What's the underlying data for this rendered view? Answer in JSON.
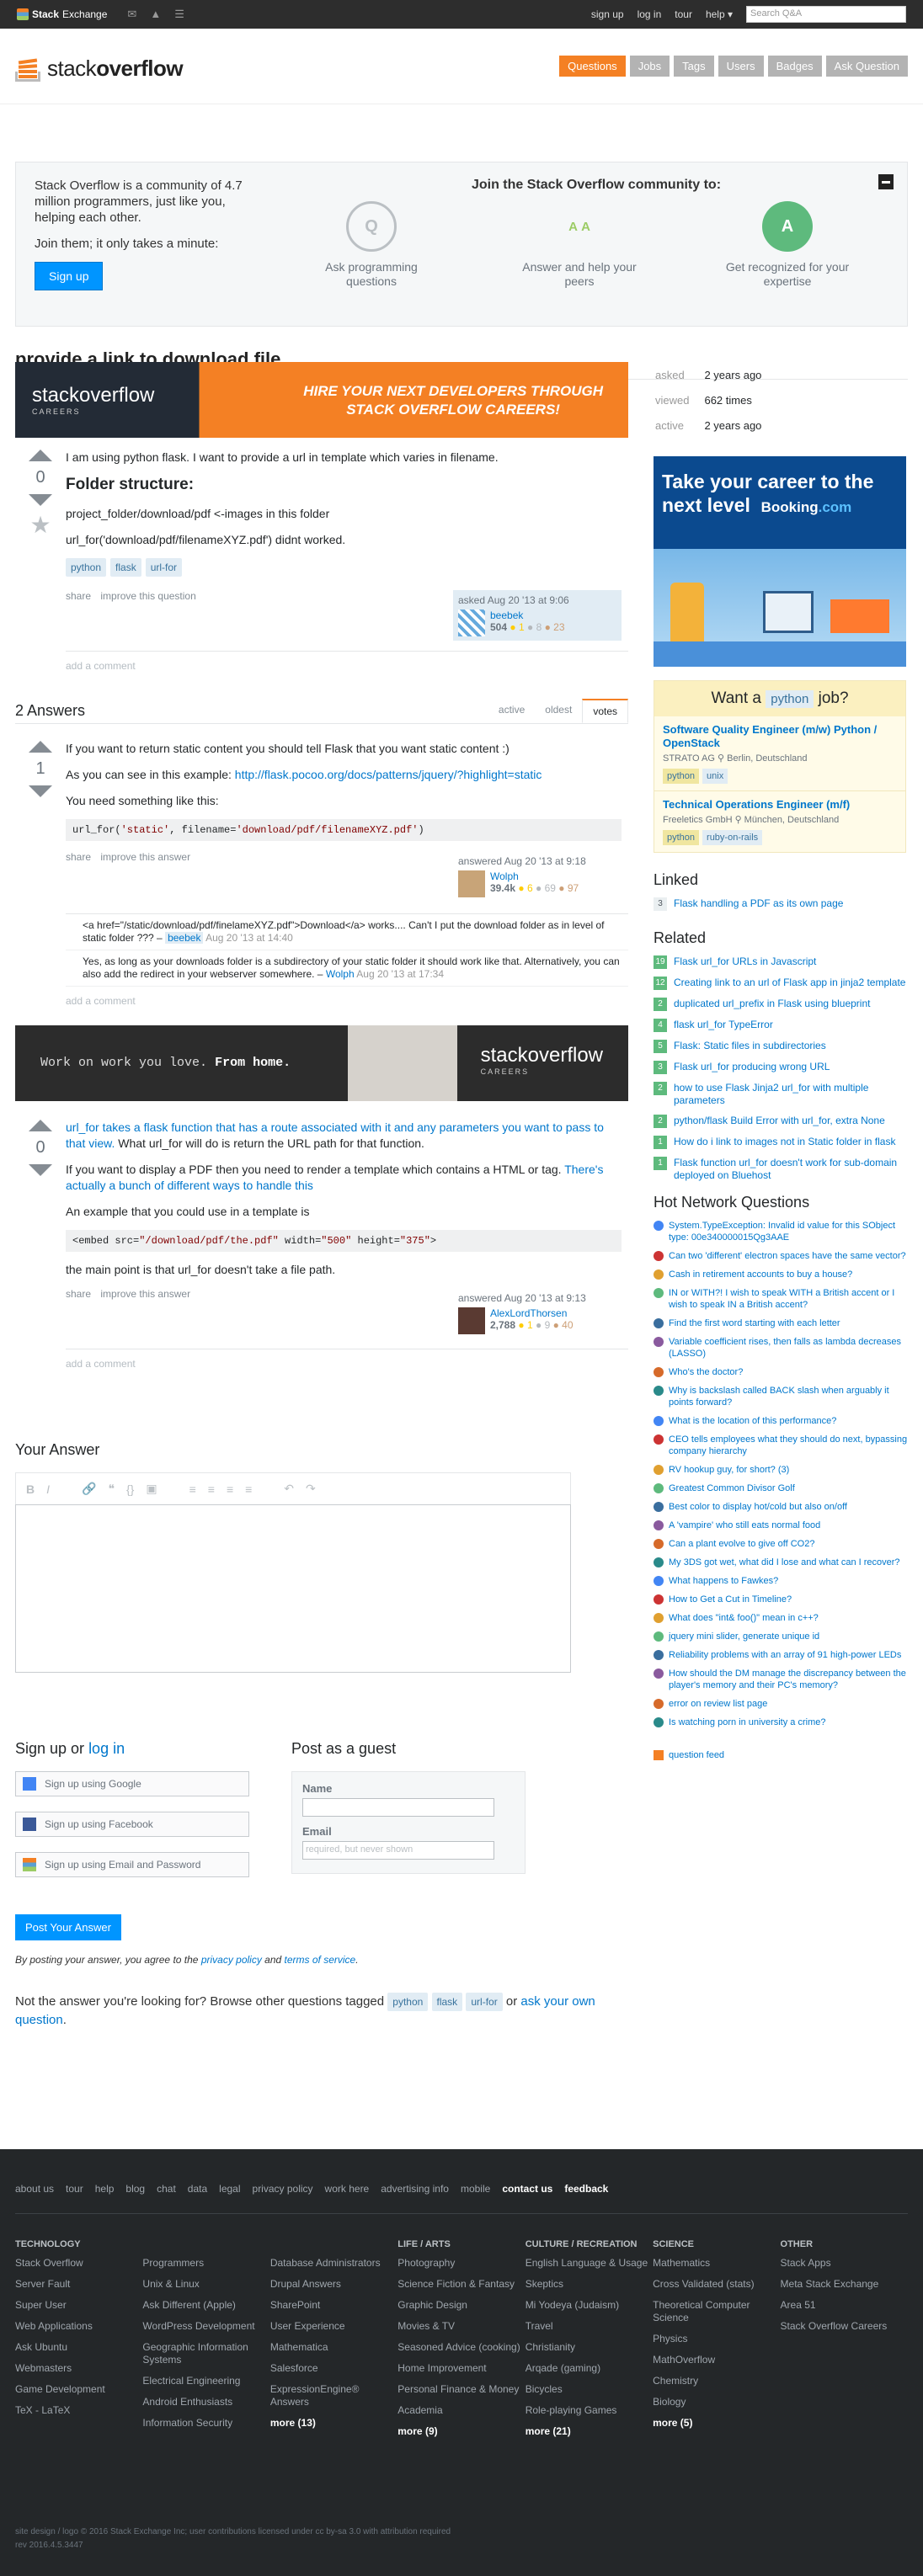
{
  "topbar": {
    "brand_a": "Stack",
    "brand_b": "Exchange",
    "links": [
      "sign up",
      "log in",
      "tour",
      "help ▾"
    ],
    "search_placeholder": "Search Q&A"
  },
  "logo": {
    "light": "stack",
    "bold": "overflow"
  },
  "nav": [
    "Questions",
    "Jobs",
    "Tags",
    "Users",
    "Badges",
    "Ask Question"
  ],
  "banner": {
    "intro": "Stack Overflow is a community of 4.7 million programmers, just like you, helping each other.",
    "join": "Join them; it only takes a minute:",
    "signup": "Sign up",
    "title": "Join the Stack Overflow community to:",
    "features": [
      "Ask programming questions",
      "Answer and help your peers",
      "Get recognized for your expertise"
    ]
  },
  "question": {
    "title": "provide a link to download file",
    "votes": "0",
    "body1": "I am using python flask. I want to provide a url in template which varies in filename.",
    "heading": "Folder structure:",
    "body2": "project_folder/download/pdf <-images in this folder",
    "body3": "url_for('download/pdf/filenameXYZ.pdf') didnt worked.",
    "tags": [
      "python",
      "flask",
      "url-for"
    ],
    "menu": [
      "share",
      "improve this question"
    ],
    "asked": "asked Aug 20 '13 at 9:06",
    "user": "beebek",
    "rep": "504",
    "badges": [
      "● 1",
      "● 8",
      "● 23"
    ],
    "add_comment": "add a comment"
  },
  "ad1": {
    "logo": "stackoverflow",
    "sub": "CAREERS",
    "tagline1": "HIRE YOUR NEXT DEVELOPERS THROUGH",
    "tagline2": "STACK OVERFLOW CAREERS!"
  },
  "answers_header": {
    "count": "2 Answers",
    "sorts": [
      "active",
      "oldest",
      "votes"
    ]
  },
  "answer1": {
    "votes": "1",
    "p1": "If you want to return static content you should tell Flask that you want static content :)",
    "p2a": "As you can see in this example: ",
    "p2link": "http://flask.pocoo.org/docs/patterns/jquery/?highlight=static",
    "p3": "You need something like this:",
    "code_a": "url_for(",
    "code_s1": "'static'",
    "code_b": ", filename=",
    "code_s2": "'download/pdf/filenameXYZ.pdf'",
    "code_c": ")",
    "menu": [
      "share",
      "improve this answer"
    ],
    "answered": "answered Aug 20 '13 at 9:18",
    "user": "Wolph",
    "rep": "39.4k",
    "badges": [
      "● 6",
      "● 69",
      "● 97"
    ],
    "comments": [
      {
        "text": "<a href=\"/static/download/pdf/finelameXYZ.pdf\">Download</a> works.... Can't I put the download folder as in level of static folder ??? –",
        "user": "beebek",
        "date": "Aug 20 '13 at 14:40"
      },
      {
        "text": "Yes, as long as your downloads folder is a subdirectory of your static folder it should work like that. Alternatively, you can also add the redirect in your webserver somewhere. –",
        "user": "Wolph",
        "date": "Aug 20 '13 at 17:34"
      }
    ],
    "add_comment": "add a comment"
  },
  "ad2": {
    "tag_a": "Work on work you love.",
    "tag_b": "From home.",
    "logo": "stackoverflow",
    "sub": "CAREERS"
  },
  "answer2": {
    "votes": "0",
    "p1link": "url_for takes a flask function that has a route associated with it and any parameters you want to pass to that view.",
    "p1rest": " What url_for will do is return the URL path for that function.",
    "p2": "If you want to display a PDF then you need to render a template which contains a HTML or tag.",
    "p2link": "There's actually a bunch of different ways to handle this",
    "p3": "An example that you could use in a template is",
    "code_a": "<embed src=",
    "code_s1": "\"/download/pdf/the.pdf\"",
    "code_b": " width=",
    "code_s2": "\"500\"",
    "code_c": " height=",
    "code_s3": "\"375\"",
    "code_d": ">",
    "p4": "the main point is that url_for doesn't take a file path.",
    "menu": [
      "share",
      "improve this answer"
    ],
    "answered": "answered Aug 20 '13 at 9:13",
    "user": "AlexLordThorsen",
    "rep": "2,788",
    "badges": [
      "● 1",
      "● 9",
      "● 40"
    ],
    "add_comment": "add a comment"
  },
  "sidebar": {
    "info": [
      [
        "asked",
        "2 years ago"
      ],
      [
        "viewed",
        "662 times"
      ],
      [
        "active",
        "2 years ago"
      ]
    ],
    "booking": {
      "line1": "Take your career to the",
      "line2": "next level",
      "brand": "Booking",
      "brand2": ".com"
    },
    "jobs_header": {
      "pre": "Want a",
      "tag": "python",
      "post": "job?"
    },
    "jobs": [
      {
        "title": "Software Quality Engineer (m/w) Python / OpenStack",
        "company": "STRATO AG  ⚲ Berlin, Deutschland",
        "tags": [
          "python",
          "unix"
        ]
      },
      {
        "title": "Technical Operations Engineer (m/f)",
        "company": "Freeletics GmbH  ⚲ München, Deutschland",
        "tags": [
          "python",
          "ruby-on-rails"
        ]
      }
    ],
    "linked_title": "Linked",
    "linked": [
      {
        "score": "3",
        "title": "Flask handling a PDF as its own page"
      }
    ],
    "related_title": "Related",
    "related": [
      {
        "score": "19",
        "title": "Flask url_for URLs in Javascript"
      },
      {
        "score": "12",
        "title": "Creating link to an url of Flask app in jinja2 template"
      },
      {
        "score": "2",
        "title": "duplicated url_prefix in Flask using blueprint"
      },
      {
        "score": "4",
        "title": "flask url_for TypeError"
      },
      {
        "score": "5",
        "title": "Flask: Static files in subdirectories"
      },
      {
        "score": "3",
        "title": "Flask url_for producing wrong URL"
      },
      {
        "score": "2",
        "title": "how to use Flask Jinja2 url_for with multiple parameters"
      },
      {
        "score": "2",
        "title": "python/flask Build Error with url_for, extra None"
      },
      {
        "score": "1",
        "title": "How do i link to images not in Static folder in flask"
      },
      {
        "score": "1",
        "title": "Flask function url_for doesn't work for sub-domain deployed on Bluehost"
      }
    ],
    "hnq_title": "Hot Network Questions",
    "hnq": [
      "System.TypeException: Invalid id value for this SObject type: 00e340000015Qg3AAE",
      "Can two 'different' electron spaces have the same vector?",
      "Cash in retirement accounts to buy a house?",
      "IN or WITH?! I wish to speak WITH a British accent or I wish to speak IN a British accent?",
      "Find the first word starting with each letter",
      "Variable coefficient rises, then falls as lambda decreases (LASSO)",
      "Who's the doctor?",
      "Why is backslash called BACK slash when arguably it points forward?",
      "What is the location of this performance?",
      "CEO tells employees what they should do next, bypassing company hierarchy",
      "RV hookup guy, for short? (3)",
      "Greatest Common Divisor Golf",
      "Best color to display hot/cold but also on/off",
      "A 'vampire' who still eats normal food",
      "Can a plant evolve to give off CO2?",
      "My 3DS got wet, what did I lose and what can I recover?",
      "What happens to Fawkes?",
      "How to Get a Cut in Timeline?",
      "What does \"int& foo()\" mean in c++?",
      "jquery mini slider, generate unique id",
      "Reliability problems with an array of 91 high-power LEDs",
      "How should the DM manage the discrepancy between the player's memory and their PC's memory?",
      "error on review list page",
      "Is watching porn in university a crime?"
    ],
    "feed": "question feed"
  },
  "your_answer": {
    "title": "Your Answer",
    "toolbar": [
      "B",
      "I",
      "🔗",
      "❝",
      "{}",
      "▣",
      "≡",
      "≡",
      "≡",
      "≡",
      "↶",
      "↷"
    ],
    "signup_title_a": "Sign up or ",
    "signup_title_link": "log in",
    "social": [
      "Sign up using Google",
      "Sign up using Facebook",
      "Sign up using Email and Password"
    ],
    "guest_title": "Post as a guest",
    "name_label": "Name",
    "email_label": "Email",
    "email_placeholder": "required, but never shown",
    "post_button": "Post Your Answer",
    "terms_a": "By posting your answer, you agree to the ",
    "privacy": "privacy policy",
    "terms_b": " and ",
    "tos": "terms of service",
    "terms_c": ".",
    "notans_a": "Not the answer you're looking for? Browse other questions tagged ",
    "notans_tags": [
      "python",
      "flask",
      "url-for"
    ],
    "notans_b": " or ",
    "notans_link": "ask your own question",
    "notans_c": "."
  },
  "footer": {
    "links": [
      "about us",
      "tour",
      "help",
      "blog",
      "chat",
      "data",
      "legal",
      "privacy policy",
      "work here",
      "advertising info",
      "mobile",
      "contact us",
      "feedback"
    ],
    "columns": [
      {
        "title": "TECHNOLOGY",
        "items": [
          "Stack Overflow",
          "Server Fault",
          "Super User",
          "Web Applications",
          "Ask Ubuntu",
          "Webmasters",
          "Game Development",
          "TeX - LaTeX"
        ]
      },
      {
        "title": "",
        "items": [
          "Programmers",
          "Unix & Linux",
          "Ask Different (Apple)",
          "WordPress Development",
          "Geographic Information Systems",
          "Electrical Engineering",
          "Android Enthusiasts",
          "Information Security"
        ]
      },
      {
        "title": "",
        "items": [
          "Database Administrators",
          "Drupal Answers",
          "SharePoint",
          "User Experience",
          "Mathematica",
          "Salesforce",
          "ExpressionEngine® Answers"
        ],
        "more": "more (13)"
      },
      {
        "title": "LIFE / ARTS",
        "items": [
          "Photography",
          "Science Fiction & Fantasy",
          "Graphic Design",
          "Movies & TV",
          "Seasoned Advice (cooking)",
          "Home Improvement",
          "Personal Finance & Money",
          "Academia"
        ],
        "more": "more (9)"
      },
      {
        "title": "CULTURE / RECREATION",
        "items": [
          "English Language & Usage",
          "Skeptics",
          "Mi Yodeya (Judaism)",
          "Travel",
          "Christianity",
          "Arqade (gaming)",
          "Bicycles",
          "Role-playing Games"
        ],
        "more": "more (21)"
      },
      {
        "title": "SCIENCE",
        "items": [
          "Mathematics",
          "Cross Validated (stats)",
          "Theoretical Computer Science",
          "Physics",
          "MathOverflow",
          "Chemistry",
          "Biology"
        ],
        "more": "more (5)"
      },
      {
        "title": "OTHER",
        "items": [
          "Stack Apps",
          "Meta Stack Exchange",
          "Area 51",
          "Stack Overflow Careers"
        ]
      }
    ],
    "copy1": "site design / logo © 2016 Stack Exchange Inc; user contributions licensed under cc by-sa 3.0 with attribution required",
    "copy2": "rev 2016.4.5.3447"
  },
  "colors": {
    "accent": "#f48024",
    "link": "#0077cc",
    "tag_bg": "#e1ecf4",
    "footer_bg": "#242729"
  }
}
